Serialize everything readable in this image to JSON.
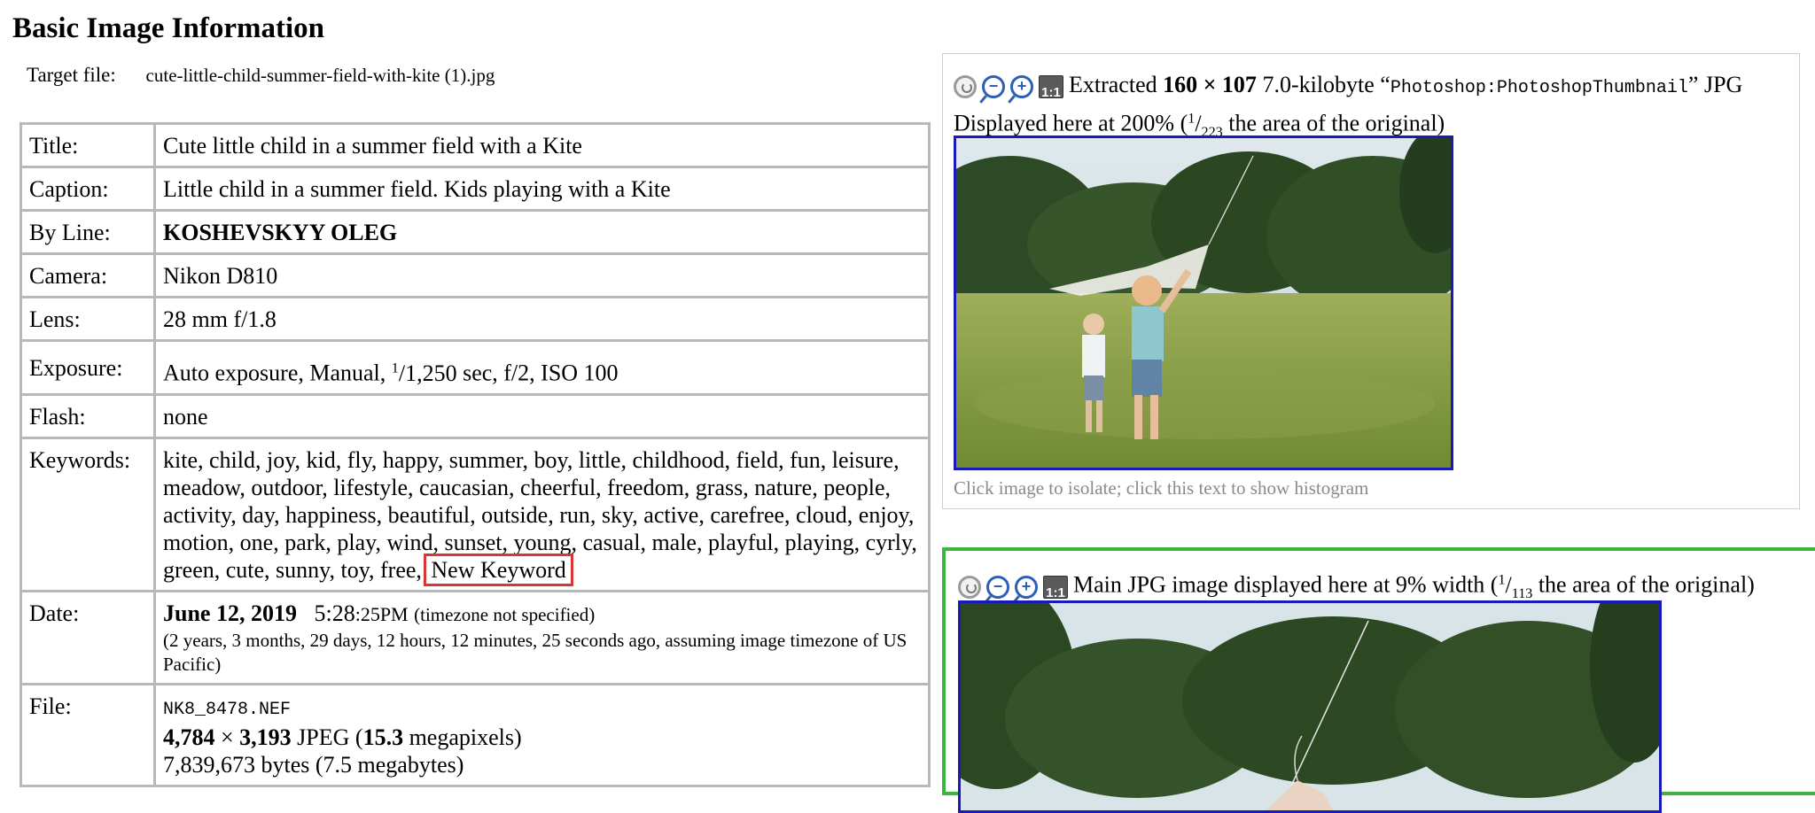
{
  "heading": "Basic Image Information",
  "target": {
    "label": "Target file:",
    "value": "cute-little-child-summer-field-with-kite (1).jpg"
  },
  "rows": {
    "title": {
      "label": "Title:",
      "value": "Cute little child in a summer field with a Kite"
    },
    "caption": {
      "label": "Caption:",
      "value": "Little child in a summer field. Kids playing with a Kite"
    },
    "byline": {
      "label": "By Line:",
      "value": "KOSHEVSKYY OLEG"
    },
    "camera": {
      "label": "Camera:",
      "value": "Nikon D810"
    },
    "lens": {
      "label": "Lens:",
      "value": "28 mm f/1.8"
    },
    "exposure": {
      "label": "Exposure:",
      "prefix": "Auto exposure, Manual, ",
      "num": "1",
      "den": "1,250",
      "suffix": " sec, f/2, ISO 100"
    },
    "flash": {
      "label": "Flash:",
      "value": "none"
    },
    "keywords": {
      "label": "Keywords:",
      "value": "kite, child, joy, kid, fly, happy, summer, boy, little, childhood, field, fun, leisure, meadow, outdoor, lifestyle, caucasian, cheerful, freedom, grass, nature, people, activity, day, happiness, beautiful, outside, run, sky, active, carefree, cloud, enjoy, motion, one, park, play, wind, sunset, young, casual, male, playful, playing, cyrly, green, cute, sunny, toy, free, ",
      "new": "New Keyword"
    },
    "date": {
      "label": "Date:",
      "date": "June 12, 2019",
      "time": "5:28",
      "seconds": ":25PM",
      "tz": "(timezone not specified)",
      "ago": "(2 years, 3 months, 29 days, 12 hours, 12 minutes, 25 seconds ago, assuming image timezone of US Pacific)"
    },
    "file": {
      "label": "File:",
      "name": "NK8_8478.NEF",
      "w": "4,784",
      "times": " × ",
      "h": "3,193",
      "fmt": " JPEG (",
      "mp": "15.3",
      "mp_label": " megapixels)",
      "bytes": "7,839,673 bytes (7.5 megabytes)"
    }
  },
  "thumbnail": {
    "t1": "Extracted ",
    "w": "160 × 107",
    "t2": " 7.0-kilobyte “",
    "tag": "Photoshop:PhotoshopThumbnail",
    "t3": "” JPG",
    "line2_pre": "Displayed here at 200% (",
    "num": "1",
    "den": "223",
    "line2_post": " the area of the original)",
    "caption": "Click image to isolate; click this text to show histogram"
  },
  "main_image": {
    "pre": "Main JPG image displayed here at 9% width (",
    "num": "1",
    "den": "113",
    "post": " the area of the original)"
  },
  "tools": [
    "reset-icon",
    "zoom-out-icon",
    "zoom-in-icon",
    "actual-size-icon"
  ],
  "tool_one_label": "1:1",
  "colors": {
    "image_border": "#1a1ab8",
    "highlight": "#d93535",
    "panel_green": "#3db63d"
  }
}
